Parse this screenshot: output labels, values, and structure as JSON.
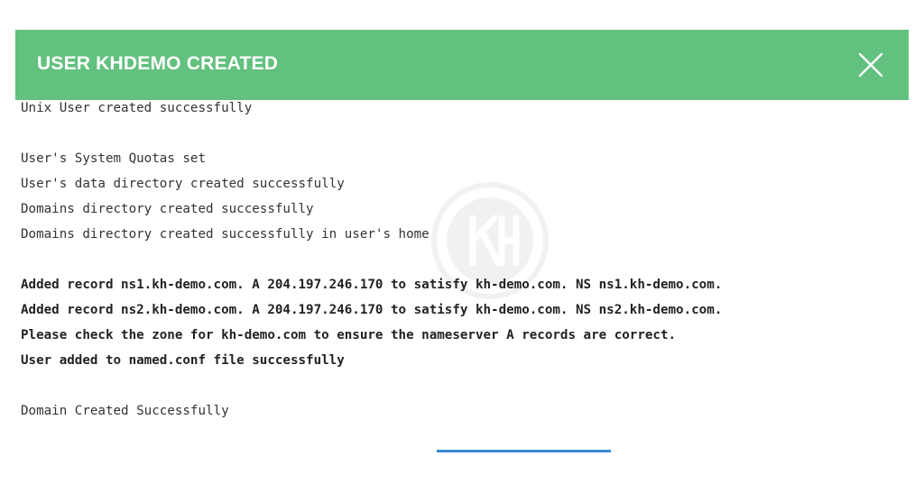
{
  "modal": {
    "title": "USER KHDEMO CREATED",
    "header_color": "#63c17f",
    "close_icon": "close-icon"
  },
  "output": {
    "lines": [
      {
        "text": "Unix User created successfully",
        "bold": false
      },
      {
        "text": "",
        "bold": false
      },
      {
        "text": "User's System Quotas set",
        "bold": false
      },
      {
        "text": "User's data directory created successfully",
        "bold": false
      },
      {
        "text": "Domains directory created successfully",
        "bold": false
      },
      {
        "text": "Domains directory created successfully in user's home",
        "bold": false
      },
      {
        "text": "",
        "bold": false
      },
      {
        "text": "Added record ns1.kh-demo.com. A 204.197.246.170 to satisfy kh-demo.com. NS ns1.kh-demo.com.",
        "bold": true
      },
      {
        "text": "Added record ns2.kh-demo.com. A 204.197.246.170 to satisfy kh-demo.com. NS ns2.kh-demo.com.",
        "bold": true
      },
      {
        "text": "Please check the zone for kh-demo.com to ensure the nameserver A records are correct.",
        "bold": true
      },
      {
        "text": "User added to named.conf file successfully",
        "bold": true
      },
      {
        "text": "",
        "bold": false
      },
      {
        "text": "Domain Created Successfully",
        "bold": false
      }
    ]
  },
  "progress": {
    "fraction": 1.0,
    "color": "#3a86cf"
  }
}
